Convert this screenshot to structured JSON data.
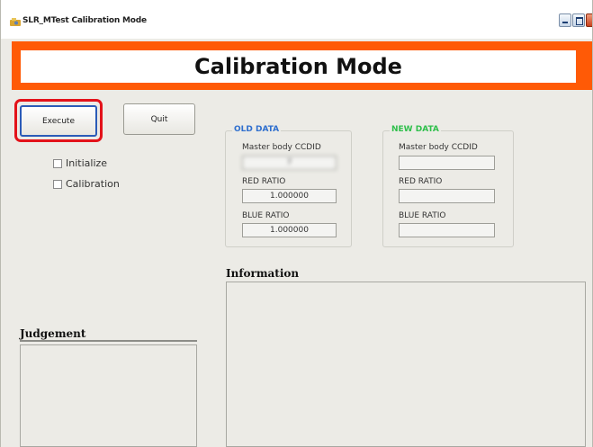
{
  "window": {
    "title": "SLR_MTest Calibration Mode",
    "icon": "app-icon"
  },
  "header": {
    "title": "Calibration Mode"
  },
  "buttons": {
    "execute_label": "Execute",
    "quit_label": "Quit"
  },
  "options": {
    "initialize_label": "Initialize",
    "initialize_checked": false,
    "calibration_label": "Calibration",
    "calibration_checked": false
  },
  "old_data": {
    "title": "OLD DATA",
    "ccdid_label": "Master body  CCDID",
    "ccdid_value": "7",
    "red_ratio_label": "RED RATIO",
    "red_ratio_value": "1.000000",
    "blue_ratio_label": "BLUE RATIO",
    "blue_ratio_value": "1.000000"
  },
  "new_data": {
    "title": "NEW DATA",
    "ccdid_label": "Master body  CCDID",
    "ccdid_value": "",
    "red_ratio_label": "RED RATIO",
    "red_ratio_value": "",
    "blue_ratio_label": "BLUE RATIO",
    "blue_ratio_value": ""
  },
  "information": {
    "label": "Information",
    "text": ""
  },
  "judgement": {
    "label": "Judgement",
    "text": ""
  },
  "colors": {
    "banner": "#ff5a06",
    "highlight": "#e3121a",
    "old_data_title": "#2f6fce",
    "new_data_title": "#2fbf4b"
  }
}
